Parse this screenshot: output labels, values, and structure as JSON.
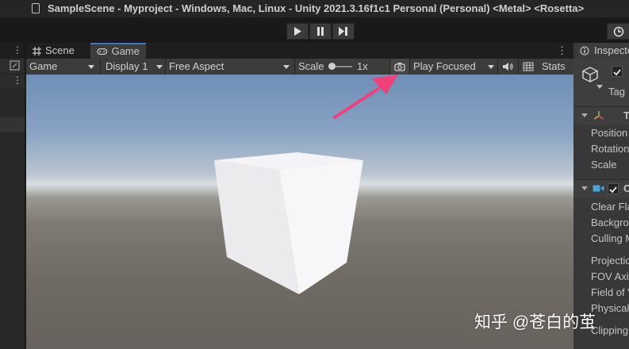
{
  "window": {
    "title": "SampleScene - Myproject - Windows, Mac, Linux - Unity 2021.3.16f1c1 Personal (Personal) <Metal> <Rosetta>"
  },
  "toolbar": {
    "play_icon": "play-icon",
    "pause_icon": "pause-icon",
    "step_icon": "step-icon",
    "history_icon": "history-icon"
  },
  "tabs": [
    {
      "label": "Scene",
      "icon": "scene-grid-icon"
    },
    {
      "label": "Game",
      "icon": "gamepad-icon"
    }
  ],
  "game_bar": {
    "view_mode": "Game",
    "display": "Display 1",
    "aspect": "Free Aspect",
    "scale_label": "Scale",
    "scale_value": "1x",
    "camera_icon": "camera-icon",
    "play_mode": "Play Focused",
    "audio_icon": "speaker-icon",
    "stats_label": "Stats"
  },
  "inspector": {
    "tab_label": "Inspector",
    "tag_label": "Tag",
    "transform_header": "T",
    "transform_fields": [
      "Position",
      "Rotation",
      "Scale"
    ],
    "camera_header": "C",
    "camera_fields": [
      "Clear Fla",
      "Backgro",
      "Culling M",
      "Projectio",
      "FOV Axis",
      "Field of V",
      "Physical",
      "Clipping"
    ]
  },
  "watermark": "知乎 @苍白的茧",
  "colors": {
    "accent": "#3a79bb",
    "annotation_arrow": "#f0407a"
  }
}
